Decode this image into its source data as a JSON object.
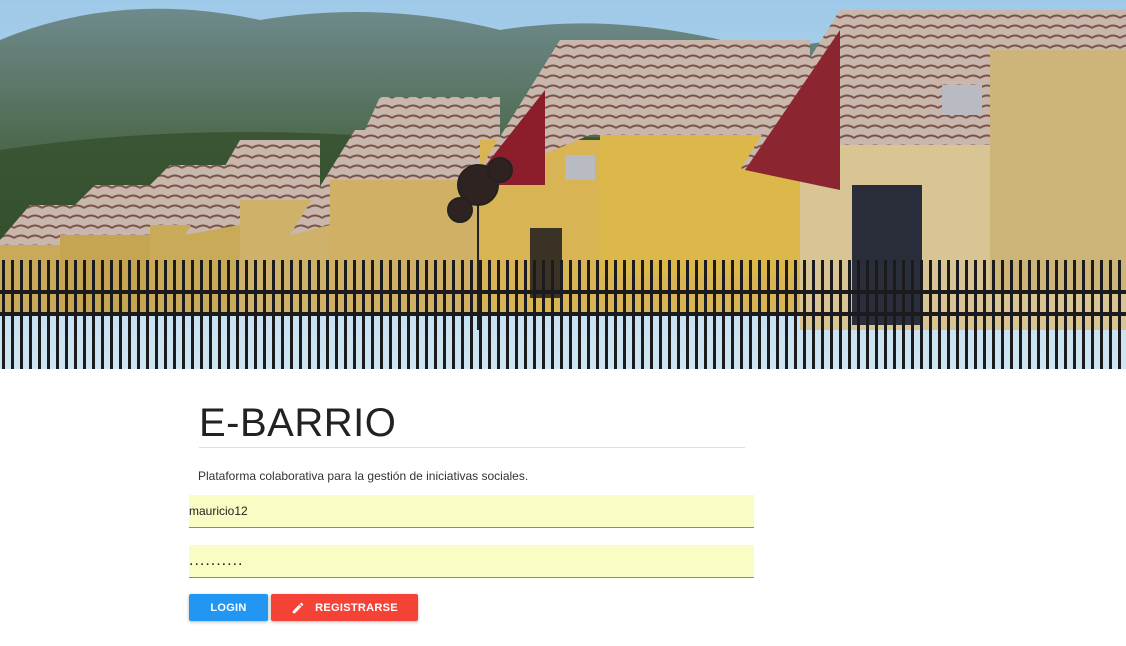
{
  "app": {
    "title": "E-BARRIO",
    "subtitle": "Plataforma colaborativa para la gestión de iniciativas sociales."
  },
  "login_form": {
    "username_value": "mauricio12",
    "password_value": "..........",
    "login_label": "LOGIN",
    "register_label": "REGISTRARSE"
  },
  "colors": {
    "login_button": "#2196f3",
    "register_button": "#f44336",
    "field_autofill": "#fafdc3"
  },
  "icons": {
    "register": "pencil-icon"
  }
}
